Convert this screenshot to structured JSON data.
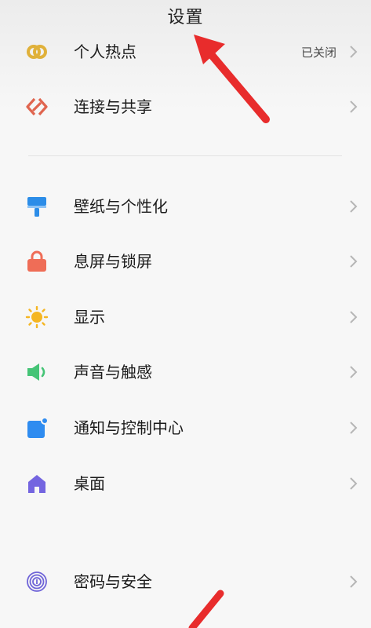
{
  "page": {
    "title": "设置"
  },
  "items": [
    {
      "label": "个人热点",
      "value": "已关闭",
      "icon": "hotspot-link-icon",
      "color": "#e0b13a"
    },
    {
      "label": "连接与共享",
      "value": "",
      "icon": "share-diamond-icon",
      "color": "#e0654f"
    },
    {
      "label": "壁纸与个性化",
      "value": "",
      "icon": "paintbrush-icon",
      "color": "#2c8de8"
    },
    {
      "label": "息屏与锁屏",
      "value": "",
      "icon": "lock-icon",
      "color": "#ef6d57"
    },
    {
      "label": "显示",
      "value": "",
      "icon": "sun-icon",
      "color": "#f5b623"
    },
    {
      "label": "声音与触感",
      "value": "",
      "icon": "speaker-icon",
      "color": "#45c476"
    },
    {
      "label": "通知与控制中心",
      "value": "",
      "icon": "notification-icon",
      "color": "#2f8cf0"
    },
    {
      "label": "桌面",
      "value": "",
      "icon": "home-icon",
      "color": "#7465e0"
    },
    {
      "label": "密码与安全",
      "value": "",
      "icon": "fingerprint-icon",
      "color": "#6f64d8"
    }
  ],
  "colors": {
    "annotation_arrow": "#e82c2c",
    "chevron": "#b6b6b6"
  }
}
